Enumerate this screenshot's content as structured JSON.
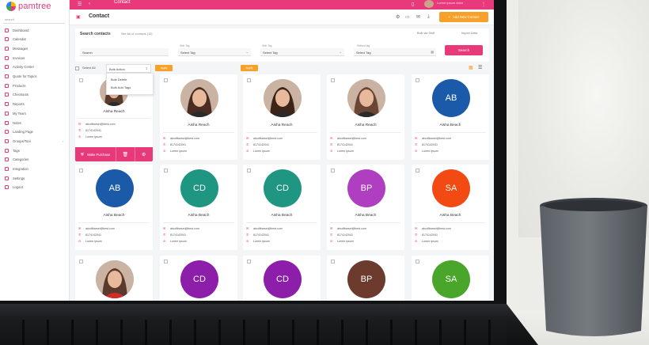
{
  "app": {
    "logo_text": "pamtree",
    "breadcrumb": "Contact",
    "user_name": "Lorem ipsum dolor"
  },
  "colors": {
    "brand_pink": "#e8397a",
    "accent_orange": "#f7a12b"
  },
  "sidebar": {
    "search_placeholder": "search",
    "items": [
      {
        "label": "Dashboard",
        "icon": "dashboard-icon"
      },
      {
        "label": "Calendar",
        "icon": "calendar-icon"
      },
      {
        "label": "Messages",
        "icon": "messages-icon"
      },
      {
        "label": "Invoices",
        "icon": "invoice-icon"
      },
      {
        "label": "Activity Center",
        "icon": "activity-icon"
      },
      {
        "label": "Quote for Topics",
        "icon": "quote-icon"
      },
      {
        "label": "Products",
        "icon": "products-icon"
      },
      {
        "label": "Checkouts",
        "icon": "checkout-icon"
      },
      {
        "label": "Reports",
        "icon": "reports-icon"
      },
      {
        "label": "My Team",
        "icon": "team-icon"
      },
      {
        "label": "Notes",
        "icon": "notes-icon"
      },
      {
        "label": "Landing Page",
        "icon": "landing-icon"
      },
      {
        "label": "Groups/Tool",
        "icon": "groups-icon",
        "has_submenu": true
      },
      {
        "label": "Tags",
        "icon": "tags-icon"
      },
      {
        "label": "Categories",
        "icon": "categories-icon"
      },
      {
        "label": "Integration",
        "icon": "integration-icon"
      },
      {
        "label": "Settings",
        "icon": "settings-icon"
      },
      {
        "label": "Logout",
        "icon": "logout-icon"
      }
    ]
  },
  "header": {
    "title": "Contact",
    "add_button": "Add New Contact"
  },
  "search_panel": {
    "title": "Search contacts",
    "subtitle": "Site list of contacts (15)",
    "link_bulk": "Bulk via Stuff",
    "link_import": "Import Data",
    "search_field": "Search",
    "filters": [
      {
        "label": "With Tag",
        "value": "Select Tag"
      },
      {
        "label": "With Tag",
        "value": "Select Tag"
      },
      {
        "label": "Without tag",
        "value": "Select Tag"
      }
    ],
    "search_button": "Search"
  },
  "toolbar": {
    "select_all": "Select All",
    "bulk_select": "Bulk Action",
    "apply_1": "Apply",
    "apply_2": "Apply",
    "dropdown_options": [
      "Bulk Delete",
      "Bulk Add Tags"
    ]
  },
  "contacts": [
    {
      "name": "Aisha Reach",
      "initials": "",
      "photo": true,
      "email": "abcdfbarsei@lbest.com",
      "phone": "8174142041",
      "note": "Lorem ipsum",
      "expanded": true
    },
    {
      "name": "Aisha Reach",
      "initials": "",
      "photo": true,
      "email": "abcdfbarsei@best.com",
      "phone": "8174142041",
      "note": "Lorem ipsum"
    },
    {
      "name": "Aisha Reach",
      "initials": "",
      "photo": true,
      "email": "abcdfbarsei@best.com",
      "phone": "8174142041",
      "note": "Lorem ipsum"
    },
    {
      "name": "Aisha Reach",
      "initials": "",
      "photo": true,
      "email": "abcdfbarsei@best.com",
      "phone": "8174142041",
      "note": "Lorem ipsum"
    },
    {
      "name": "Aisha Beach",
      "initials": "AB",
      "color": "#1a5aa8",
      "email": "abcdfbarsei@best.com",
      "phone": "8174142041",
      "note": "Lorem ipsum"
    },
    {
      "name": "Aisha Beach",
      "initials": "AB",
      "color": "#1a5aa8",
      "email": "abcdfbarsei@best.com",
      "phone": "8174142041",
      "note": "Lorem ipsum"
    },
    {
      "name": "Aisha Beach",
      "initials": "CD",
      "color": "#1e9682",
      "email": "abcdfbarsei@best.com",
      "phone": "8174142041",
      "note": "Lorem ipsum"
    },
    {
      "name": "Aisha Beach",
      "initials": "CD",
      "color": "#1e9682",
      "email": "abcdfbarsei@best.com",
      "phone": "8174142041",
      "note": "Lorem ipsum"
    },
    {
      "name": "Aisha Beach",
      "initials": "BP",
      "color": "#b03ec1",
      "email": "abcdfbarsei@best.com",
      "phone": "8174142041",
      "note": "Lorem ipsum"
    },
    {
      "name": "Aisha Beach",
      "initials": "SA",
      "color": "#f24a12",
      "email": "abcdfbarsei@best.com",
      "phone": "8174142041",
      "note": "Lorem ipsum"
    },
    {
      "name": "",
      "initials": "",
      "photo": true
    },
    {
      "name": "",
      "initials": "CD",
      "color": "#8c1eaa"
    },
    {
      "name": "",
      "initials": "CD",
      "color": "#8c1eaa"
    },
    {
      "name": "",
      "initials": "BP",
      "color": "#6d3a2e"
    },
    {
      "name": "",
      "initials": "SA",
      "color": "#4aa62a"
    }
  ],
  "card_actions": {
    "purchase": "Make Purchase"
  }
}
